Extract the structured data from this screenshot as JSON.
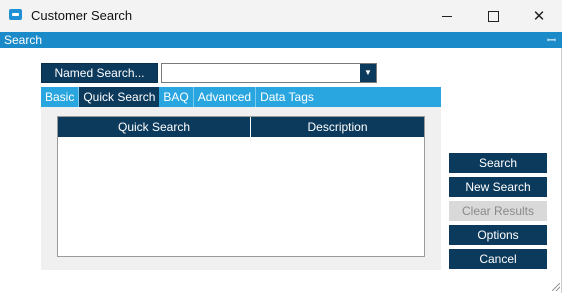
{
  "window": {
    "title": "Customer Search",
    "minimize_glyph": "minimize-icon",
    "maximize_glyph": "maximize-icon",
    "close_glyph": "✕"
  },
  "panel": {
    "label": "Search",
    "pin_glyph": "📌"
  },
  "named_search": {
    "button_label": "Named Search...",
    "selected_value": "",
    "dropdown_arrow": "▼"
  },
  "tabs": [
    {
      "label": "Basic",
      "active": false
    },
    {
      "label": "Quick Search",
      "active": true
    },
    {
      "label": "BAQ",
      "active": false
    },
    {
      "label": "Advanced",
      "active": false
    },
    {
      "label": "Data Tags",
      "active": false
    }
  ],
  "grid": {
    "columns": [
      "Quick Search",
      "Description"
    ],
    "rows": []
  },
  "actions": {
    "search": "Search",
    "new_search": "New Search",
    "clear_results": "Clear Results",
    "options": "Options",
    "cancel": "Cancel"
  },
  "colors": {
    "accent_dark": "#0c3a5c",
    "accent_blue": "#1b8ac8",
    "tab_blue": "#29a6e0"
  }
}
